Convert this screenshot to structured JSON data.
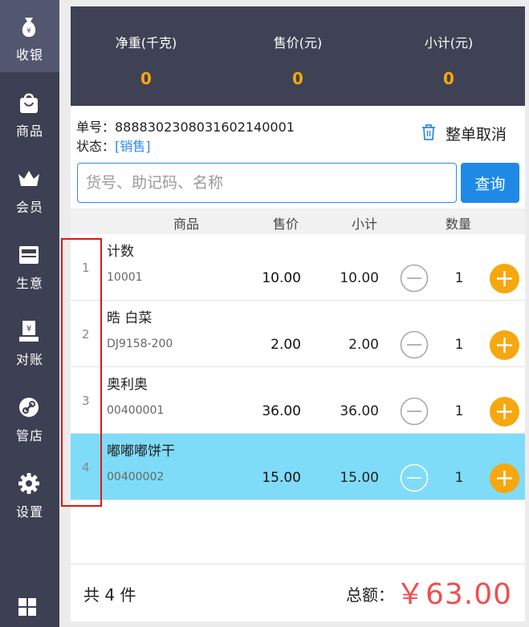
{
  "sidebar": {
    "items": [
      {
        "label": "收银",
        "icon": "money-bag-icon"
      },
      {
        "label": "商品",
        "icon": "shopping-bag-icon"
      },
      {
        "label": "会员",
        "icon": "crown-icon"
      },
      {
        "label": "生意",
        "icon": "register-icon"
      },
      {
        "label": "对账",
        "icon": "reconcile-icon"
      },
      {
        "label": "管店",
        "icon": "link-icon"
      },
      {
        "label": "设置",
        "icon": "gear-icon"
      }
    ],
    "bottom_icon": "grid-icon"
  },
  "summary": {
    "weight_label": "净重(千克)",
    "weight_value": "0",
    "price_label": "售价(元)",
    "price_value": "0",
    "subtotal_label": "小计(元)",
    "subtotal_value": "0"
  },
  "order": {
    "number": "单号：888830230803160214000​1",
    "status_prefix": "状态：",
    "status_value": "[销售]",
    "cancel_label": "整单取消"
  },
  "search": {
    "placeholder": "货号、助记码、名称",
    "button_label": "查询"
  },
  "table": {
    "headers": {
      "product": "商品",
      "price": "售价",
      "subtotal": "小计",
      "qty": "数量"
    },
    "rows": [
      {
        "index": "1",
        "name": "计数",
        "code": "10001",
        "price": "10.00",
        "subtotal": "10.00",
        "qty": "1"
      },
      {
        "index": "2",
        "name": "晧 白菜",
        "code": "DJ9158-200",
        "price": "2.00",
        "subtotal": "2.00",
        "qty": "1"
      },
      {
        "index": "3",
        "name": "奥利奥",
        "code": "00400001",
        "price": "36.00",
        "subtotal": "36.00",
        "qty": "1"
      },
      {
        "index": "4",
        "name": "嘟嘟嘟饼干",
        "code": "00400002",
        "price": "15.00",
        "subtotal": "15.00",
        "qty": "1"
      }
    ]
  },
  "footer": {
    "count_text": "共 4 件",
    "total_label": "总额：",
    "total_value": "￥63.00"
  },
  "colors": {
    "sidebar": "#3d3f52",
    "accent_orange": "#f7a70f",
    "primary_blue": "#1f8ae6",
    "selected_row": "#7fdcf8",
    "total_red": "#f04e4e",
    "highlight_box": "#e01515"
  }
}
